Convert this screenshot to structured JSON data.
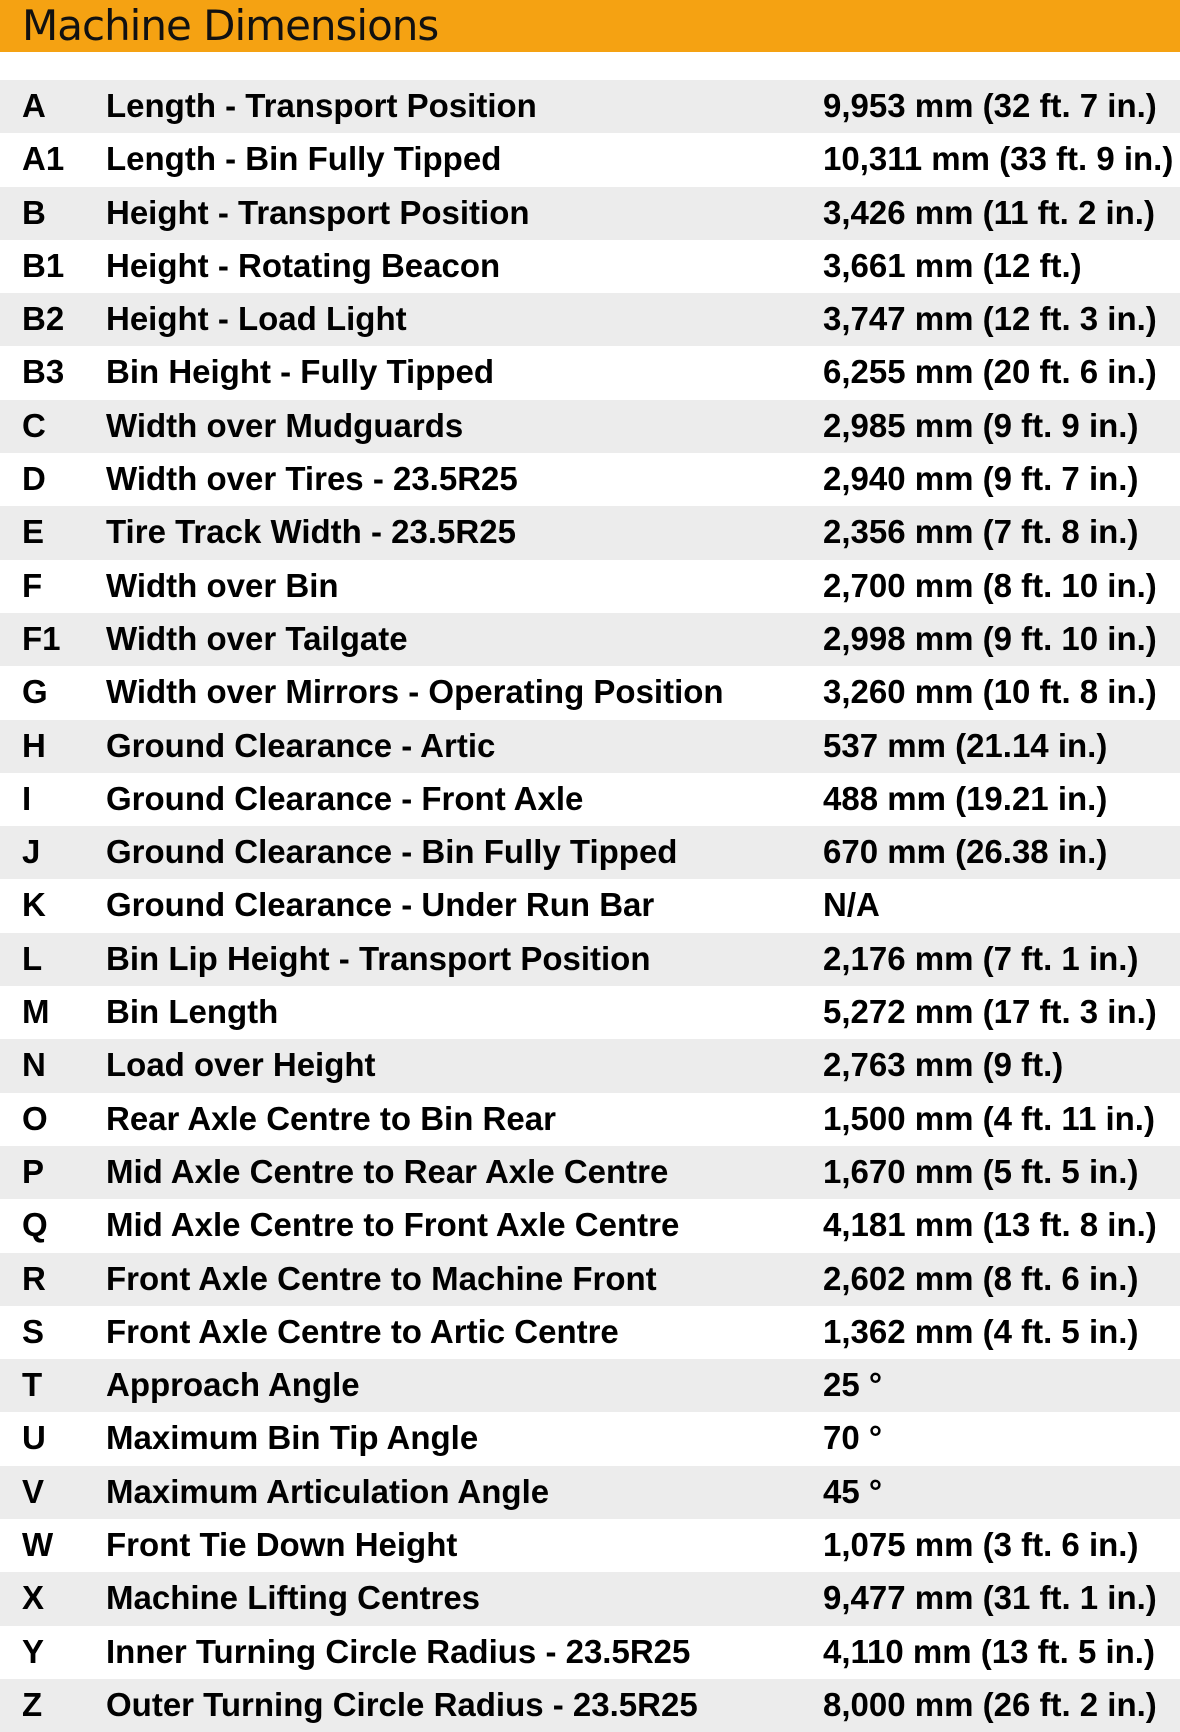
{
  "header": {
    "title": "Machine Dimensions"
  },
  "accent_color": "#f5a212",
  "rows": [
    {
      "code": "A",
      "label": "Length - Transport Position",
      "value": "9,953 mm (32 ft. 7 in.)"
    },
    {
      "code": "A1",
      "label": "Length - Bin Fully Tipped",
      "value": "10,311 mm (33 ft. 9 in.)"
    },
    {
      "code": "B",
      "label": "Height - Transport Position",
      "value": "3,426 mm (11 ft. 2 in.)"
    },
    {
      "code": "B1",
      "label": "Height - Rotating Beacon",
      "value": "3,661 mm (12 ft.)"
    },
    {
      "code": "B2",
      "label": "Height - Load Light",
      "value": "3,747 mm (12 ft. 3 in.)"
    },
    {
      "code": "B3",
      "label": "Bin Height - Fully Tipped",
      "value": "6,255 mm (20 ft. 6 in.)"
    },
    {
      "code": "C",
      "label": "Width over Mudguards",
      "value": "2,985 mm (9 ft. 9 in.)"
    },
    {
      "code": "D",
      "label": "Width over Tires - 23.5R25",
      "value": "2,940 mm (9 ft. 7 in.)"
    },
    {
      "code": "E",
      "label": "Tire Track Width - 23.5R25",
      "value": "2,356 mm (7 ft. 8 in.)"
    },
    {
      "code": "F",
      "label": "Width over Bin",
      "value": "2,700 mm (8 ft. 10 in.)"
    },
    {
      "code": "F1",
      "label": "Width over Tailgate",
      "value": "2,998 mm (9 ft. 10 in.)"
    },
    {
      "code": "G",
      "label": "Width over Mirrors - Operating Position",
      "value": "3,260 mm (10 ft. 8 in.)"
    },
    {
      "code": "H",
      "label": "Ground Clearance - Artic",
      "value": "537 mm (21.14 in.)"
    },
    {
      "code": "I",
      "label": "Ground Clearance - Front Axle",
      "value": "488 mm (19.21 in.)"
    },
    {
      "code": "J",
      "label": "Ground Clearance - Bin Fully Tipped",
      "value": "670 mm (26.38 in.)"
    },
    {
      "code": "K",
      "label": "Ground Clearance - Under Run Bar",
      "value": "N/A"
    },
    {
      "code": "L",
      "label": "Bin Lip Height - Transport Position",
      "value": "2,176 mm (7 ft. 1 in.)"
    },
    {
      "code": "M",
      "label": "Bin Length",
      "value": "5,272 mm (17 ft. 3 in.)"
    },
    {
      "code": "N",
      "label": "Load over Height",
      "value": "2,763 mm (9 ft.)"
    },
    {
      "code": "O",
      "label": "Rear Axle Centre to Bin Rear",
      "value": "1,500 mm (4 ft. 11 in.)"
    },
    {
      "code": "P",
      "label": "Mid Axle Centre to Rear Axle Centre",
      "value": "1,670 mm (5 ft. 5 in.)"
    },
    {
      "code": "Q",
      "label": "Mid Axle Centre to Front Axle Centre",
      "value": "4,181 mm (13 ft. 8 in.)"
    },
    {
      "code": "R",
      "label": "Front Axle Centre to Machine Front",
      "value": "2,602 mm (8 ft. 6 in.)"
    },
    {
      "code": "S",
      "label": "Front Axle Centre to Artic Centre",
      "value": "1,362 mm (4 ft. 5 in.)"
    },
    {
      "code": "T",
      "label": "Approach Angle",
      "value": "25 °"
    },
    {
      "code": "U",
      "label": "Maximum Bin Tip Angle",
      "value": "70 °"
    },
    {
      "code": "V",
      "label": "Maximum Articulation Angle",
      "value": "45 °"
    },
    {
      "code": "W",
      "label": "Front Tie Down Height",
      "value": "1,075 mm (3 ft. 6 in.)"
    },
    {
      "code": "X",
      "label": "Machine Lifting Centres",
      "value": "9,477 mm (31 ft. 1 in.)"
    },
    {
      "code": "Y",
      "label": "Inner Turning Circle Radius - 23.5R25",
      "value": "4,110 mm (13 ft. 5 in.)"
    },
    {
      "code": "Z",
      "label": "Outer Turning Circle Radius - 23.5R25",
      "value": "8,000 mm (26 ft. 2 in.)"
    }
  ]
}
